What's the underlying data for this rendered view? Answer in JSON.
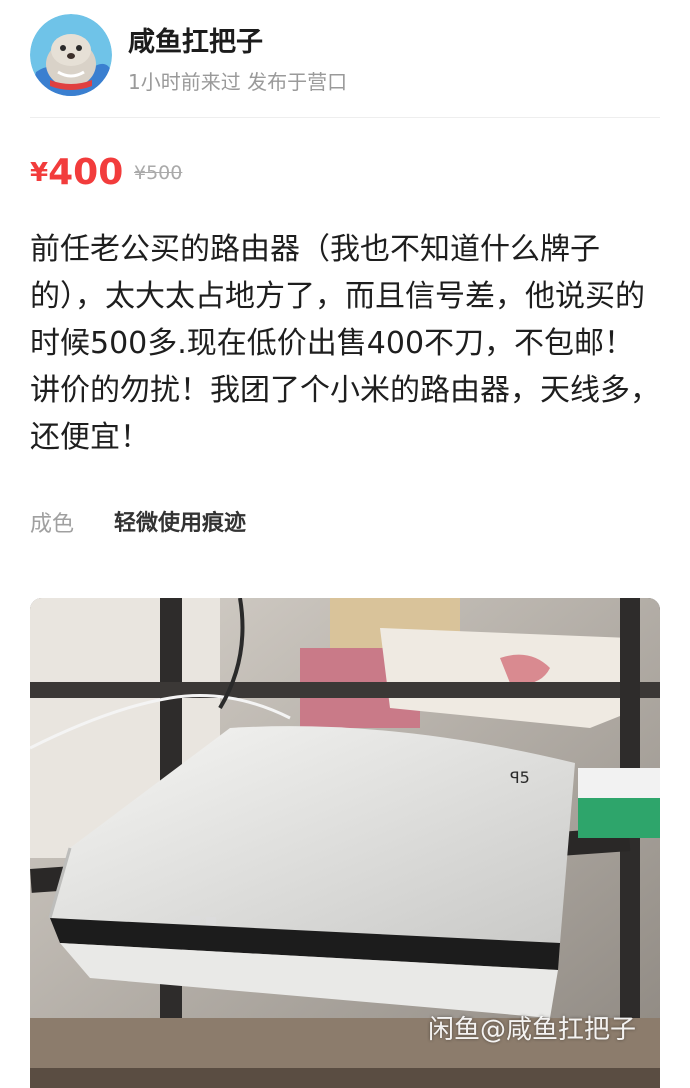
{
  "seller": {
    "name": "咸鱼扛把子",
    "meta": "1小时前来过 发布于营口",
    "avatar_icon": "seal-avatar-icon"
  },
  "price": {
    "currency": "¥",
    "value": "400",
    "original": "¥500",
    "color": "#f23c3c"
  },
  "description": "前任老公买的路由器（我也不知道什么牌子的），太大太占地方了，而且信号差，他说买的时候500多.现在低价出售400不刀，不包邮！讲价的勿扰！我团了个小米的路由器，天线多，还便宜！",
  "condition": {
    "label": "成色",
    "value": "轻微使用痕迹"
  },
  "photo": {
    "watermark": "闲鱼@咸鱼扛把子"
  }
}
